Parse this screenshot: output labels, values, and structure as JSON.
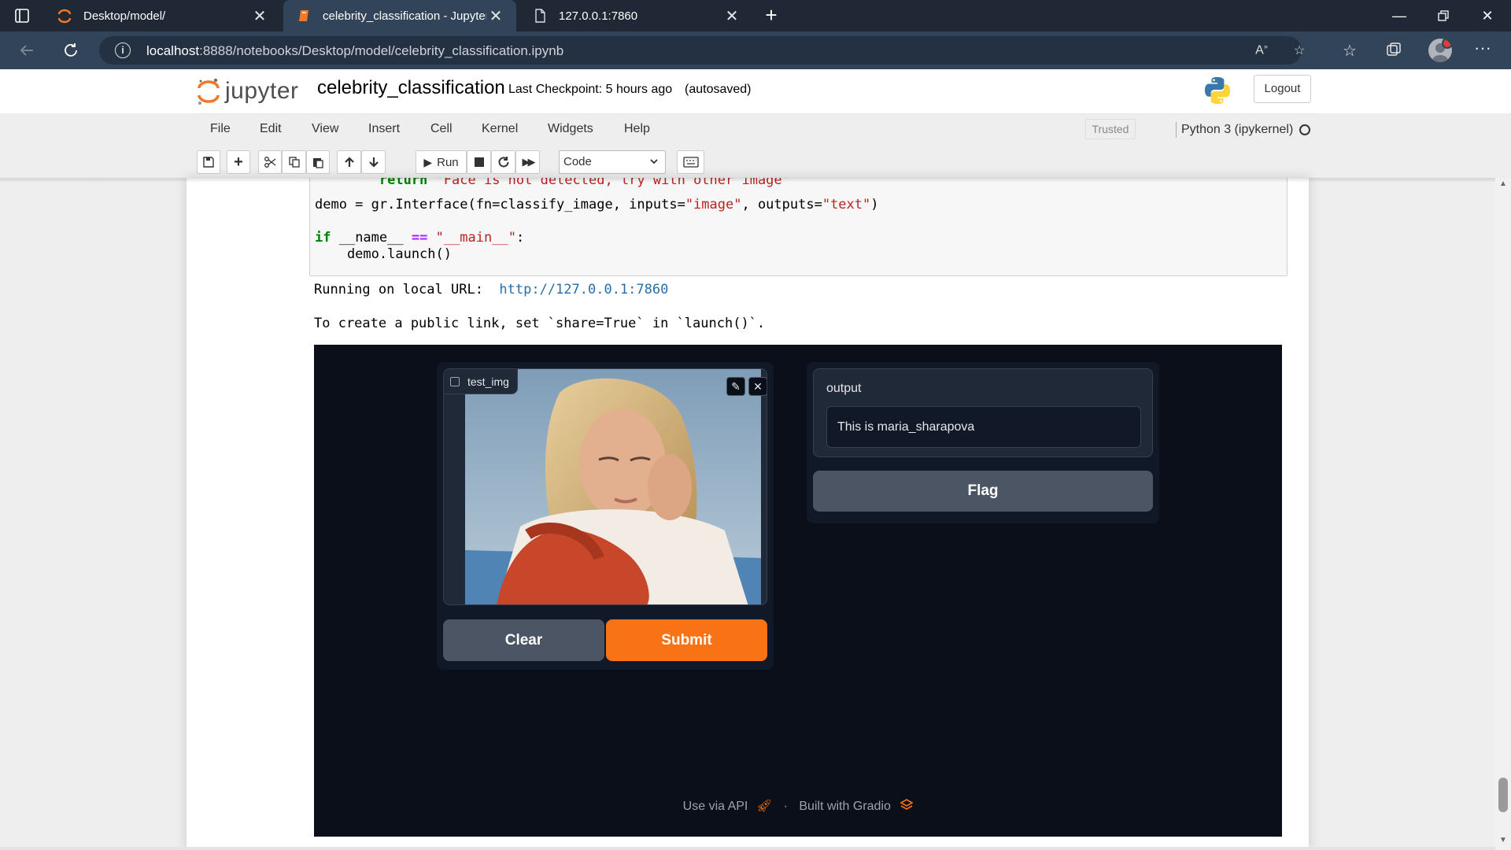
{
  "browser": {
    "tabs": [
      {
        "title": "Desktop/model/",
        "active": false,
        "favicon": "jupyter-icon"
      },
      {
        "title": "celebrity_classification - Jupyter N",
        "active": true,
        "favicon": "notebook-icon"
      },
      {
        "title": "127.0.0.1:7860",
        "active": false,
        "favicon": "page-icon"
      }
    ],
    "url_host": "localhost",
    "url_rest": ":8888/notebooks/Desktop/model/celebrity_classification.ipynb"
  },
  "jupyter": {
    "logo_text": "jupyter",
    "notebook_name": "celebrity_classification",
    "checkpoint": "Last Checkpoint: 5 hours ago",
    "autosaved": "(autosaved)",
    "logout_label": "Logout",
    "menu": [
      "File",
      "Edit",
      "View",
      "Insert",
      "Cell",
      "Kernel",
      "Widgets",
      "Help"
    ],
    "trusted_label": "Trusted",
    "kernel_name": "Python 3 (ipykernel)",
    "toolbar": {
      "run_label": "Run",
      "cell_type": "Code"
    }
  },
  "cell": {
    "partial_line": "        return \"Face is not detected, try with other image\"",
    "code_demo_prefix": "demo = gr.Interface(fn=classify_image, inputs=",
    "code_demo_s1": "\"image\"",
    "code_demo_mid": ", outputs=",
    "code_demo_s2": "\"text\"",
    "code_demo_suffix": ")",
    "code_if_kw": "if",
    "code_if_mid": " __name__ ",
    "code_if_op": "==",
    "code_if_str": "\"__main__\"",
    "code_if_end": ":",
    "code_launch": "    demo.launch()"
  },
  "output": {
    "running_prefix": "Running on local URL:  ",
    "running_url": "http://127.0.0.1:7860",
    "public_link_note": "To create a public link, set `share=True` in `launch()`."
  },
  "gradio": {
    "image_label": "test_img",
    "clear_label": "Clear",
    "submit_label": "Submit",
    "output_label": "output",
    "output_value": "This is maria_sharapova",
    "flag_label": "Flag",
    "footer_api": "Use via API",
    "footer_dot": "·",
    "footer_built": "Built with Gradio",
    "colors": {
      "submit": "#f97316",
      "background": "#0b0f19"
    }
  }
}
